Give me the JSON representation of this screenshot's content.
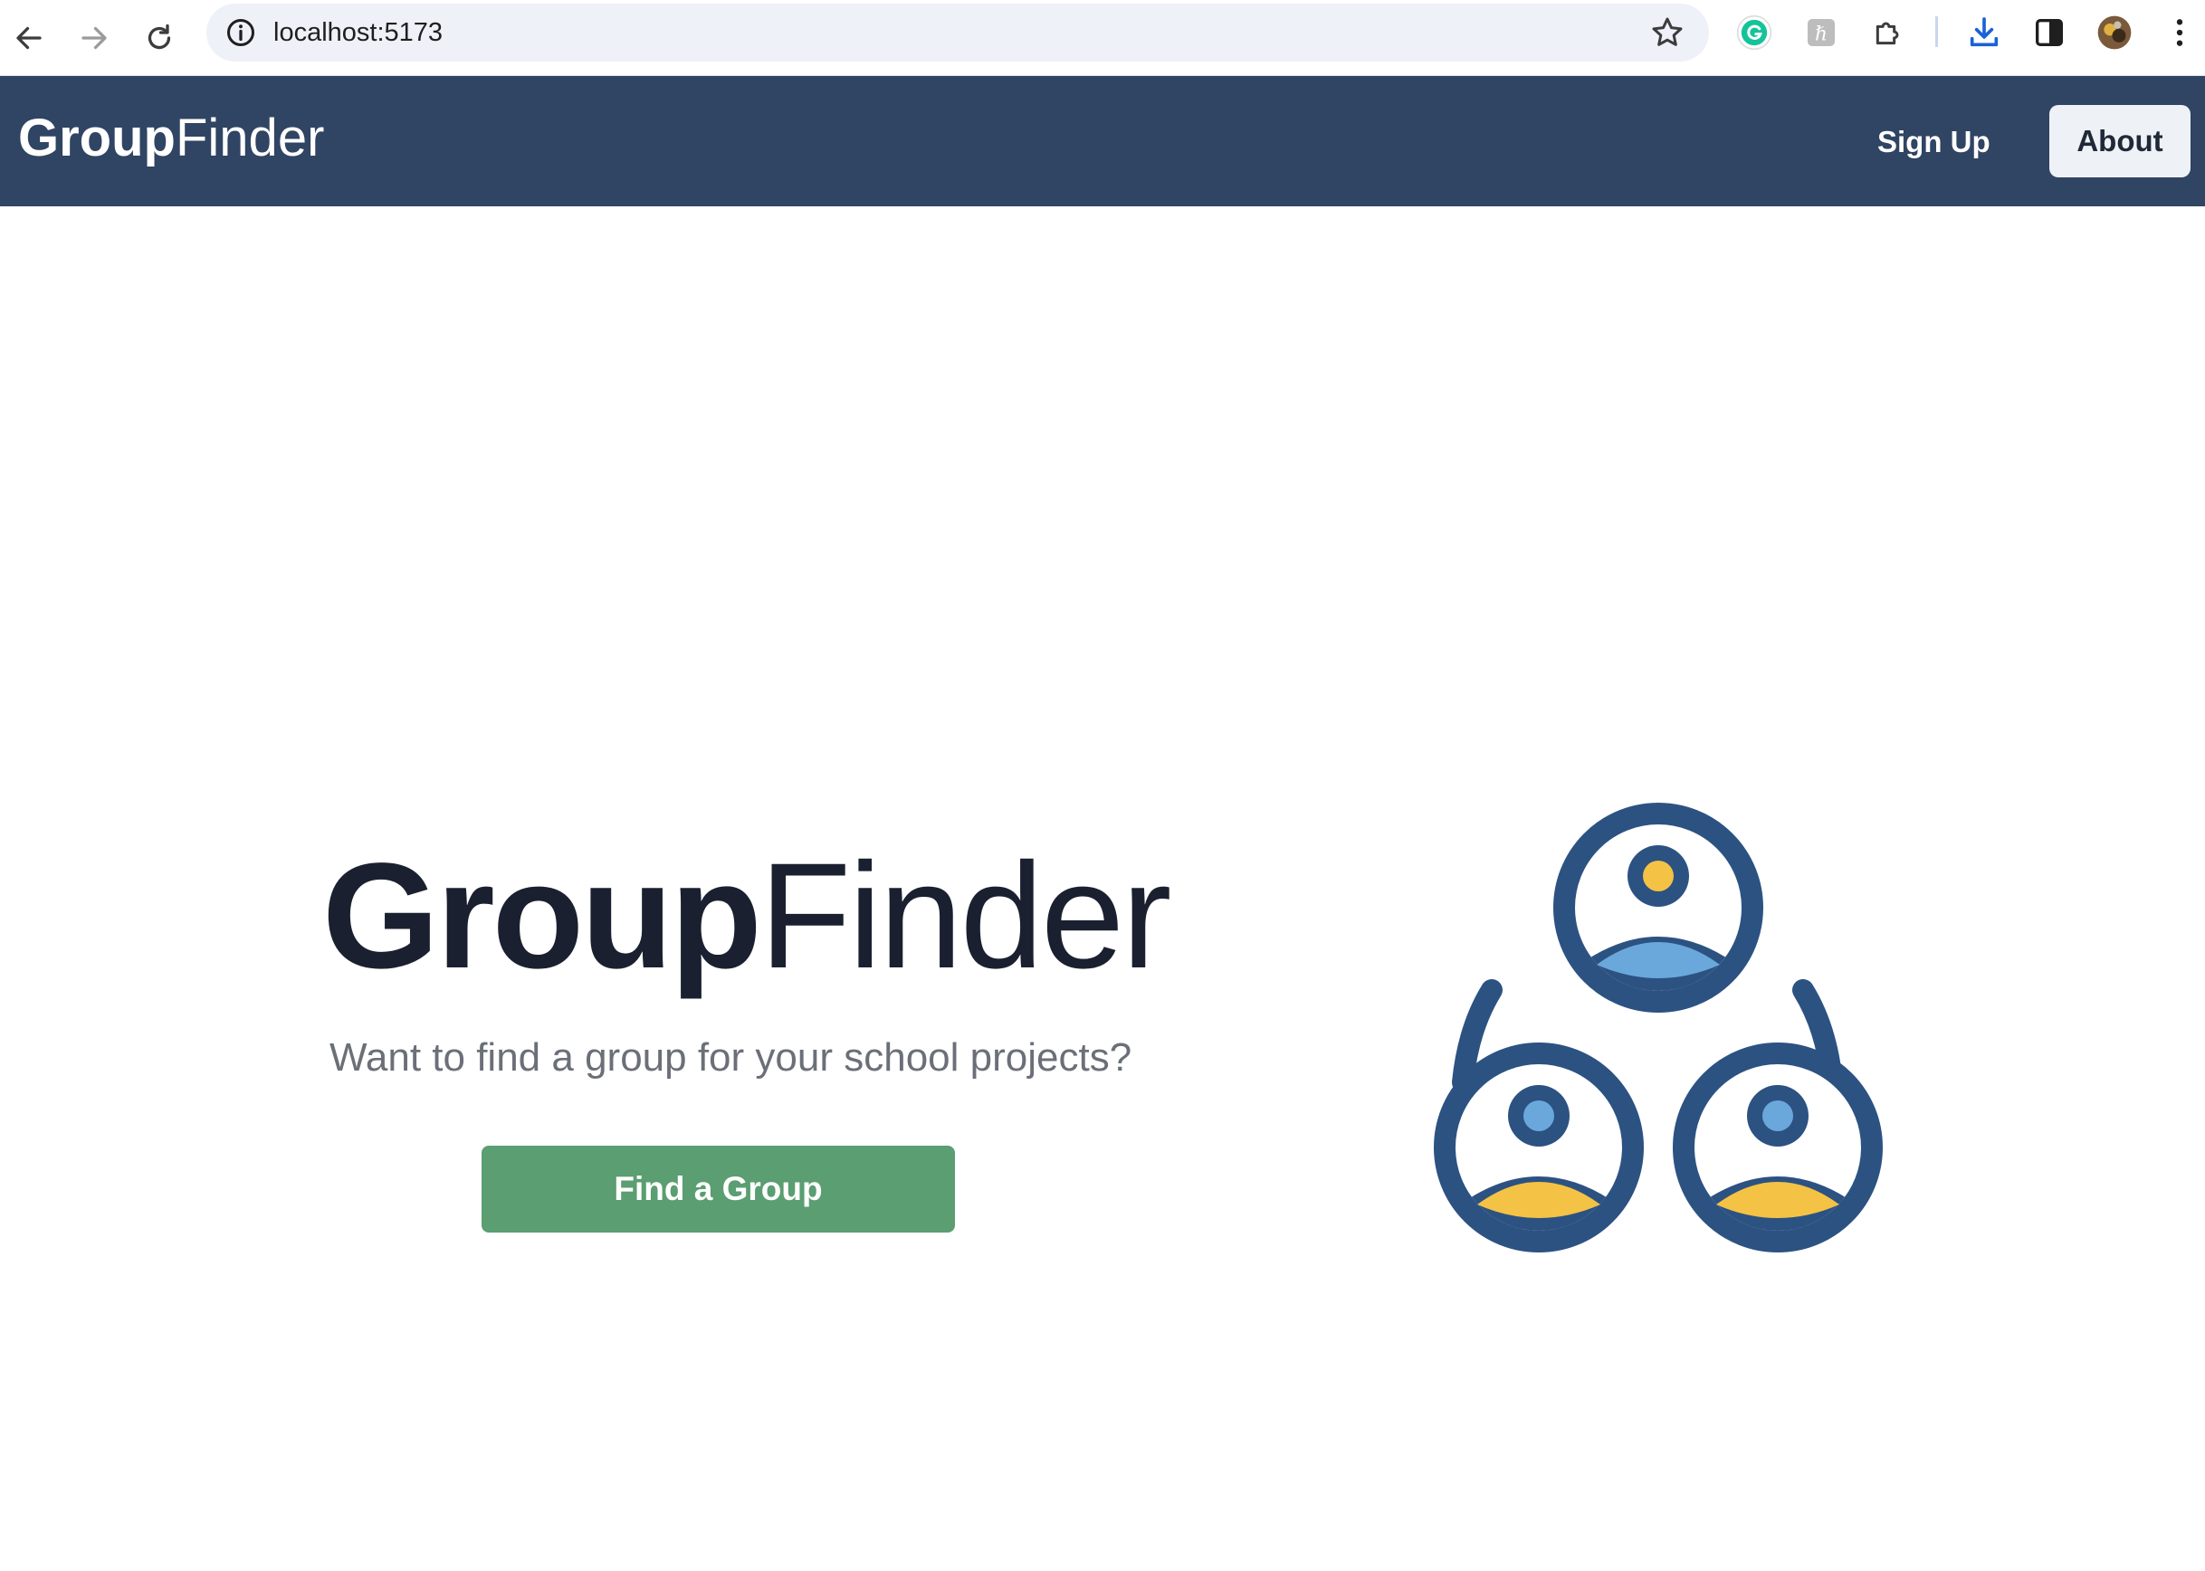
{
  "browser": {
    "url": "localhost:5173"
  },
  "navbar": {
    "brand_bold": "Group",
    "brand_light": "Finder",
    "signup_label": "Sign Up",
    "about_label": "About"
  },
  "hero": {
    "title_bold": "Group",
    "title_light": "Finder",
    "subtitle": "Want to find a group for your school projects?",
    "cta_label": "Find a Group"
  },
  "colors": {
    "navbar_bg": "#304463",
    "cta_bg": "#5a9e71",
    "icon_navy": "#2c5282",
    "icon_yellow": "#f4c244",
    "icon_blue": "#6aa8dc"
  },
  "icons": {
    "back": "arrow-left-icon",
    "forward": "arrow-right-icon",
    "reload": "reload-icon",
    "site_info": "info-icon",
    "bookmark": "star-icon",
    "grammarly": "grammarly-icon",
    "extension_h": "h-extension-icon",
    "extensions": "puzzle-icon",
    "download": "download-icon",
    "side_panel": "side-panel-icon",
    "profile": "avatar",
    "menu": "kebab-menu-icon",
    "illustration": "group-people-icon"
  }
}
